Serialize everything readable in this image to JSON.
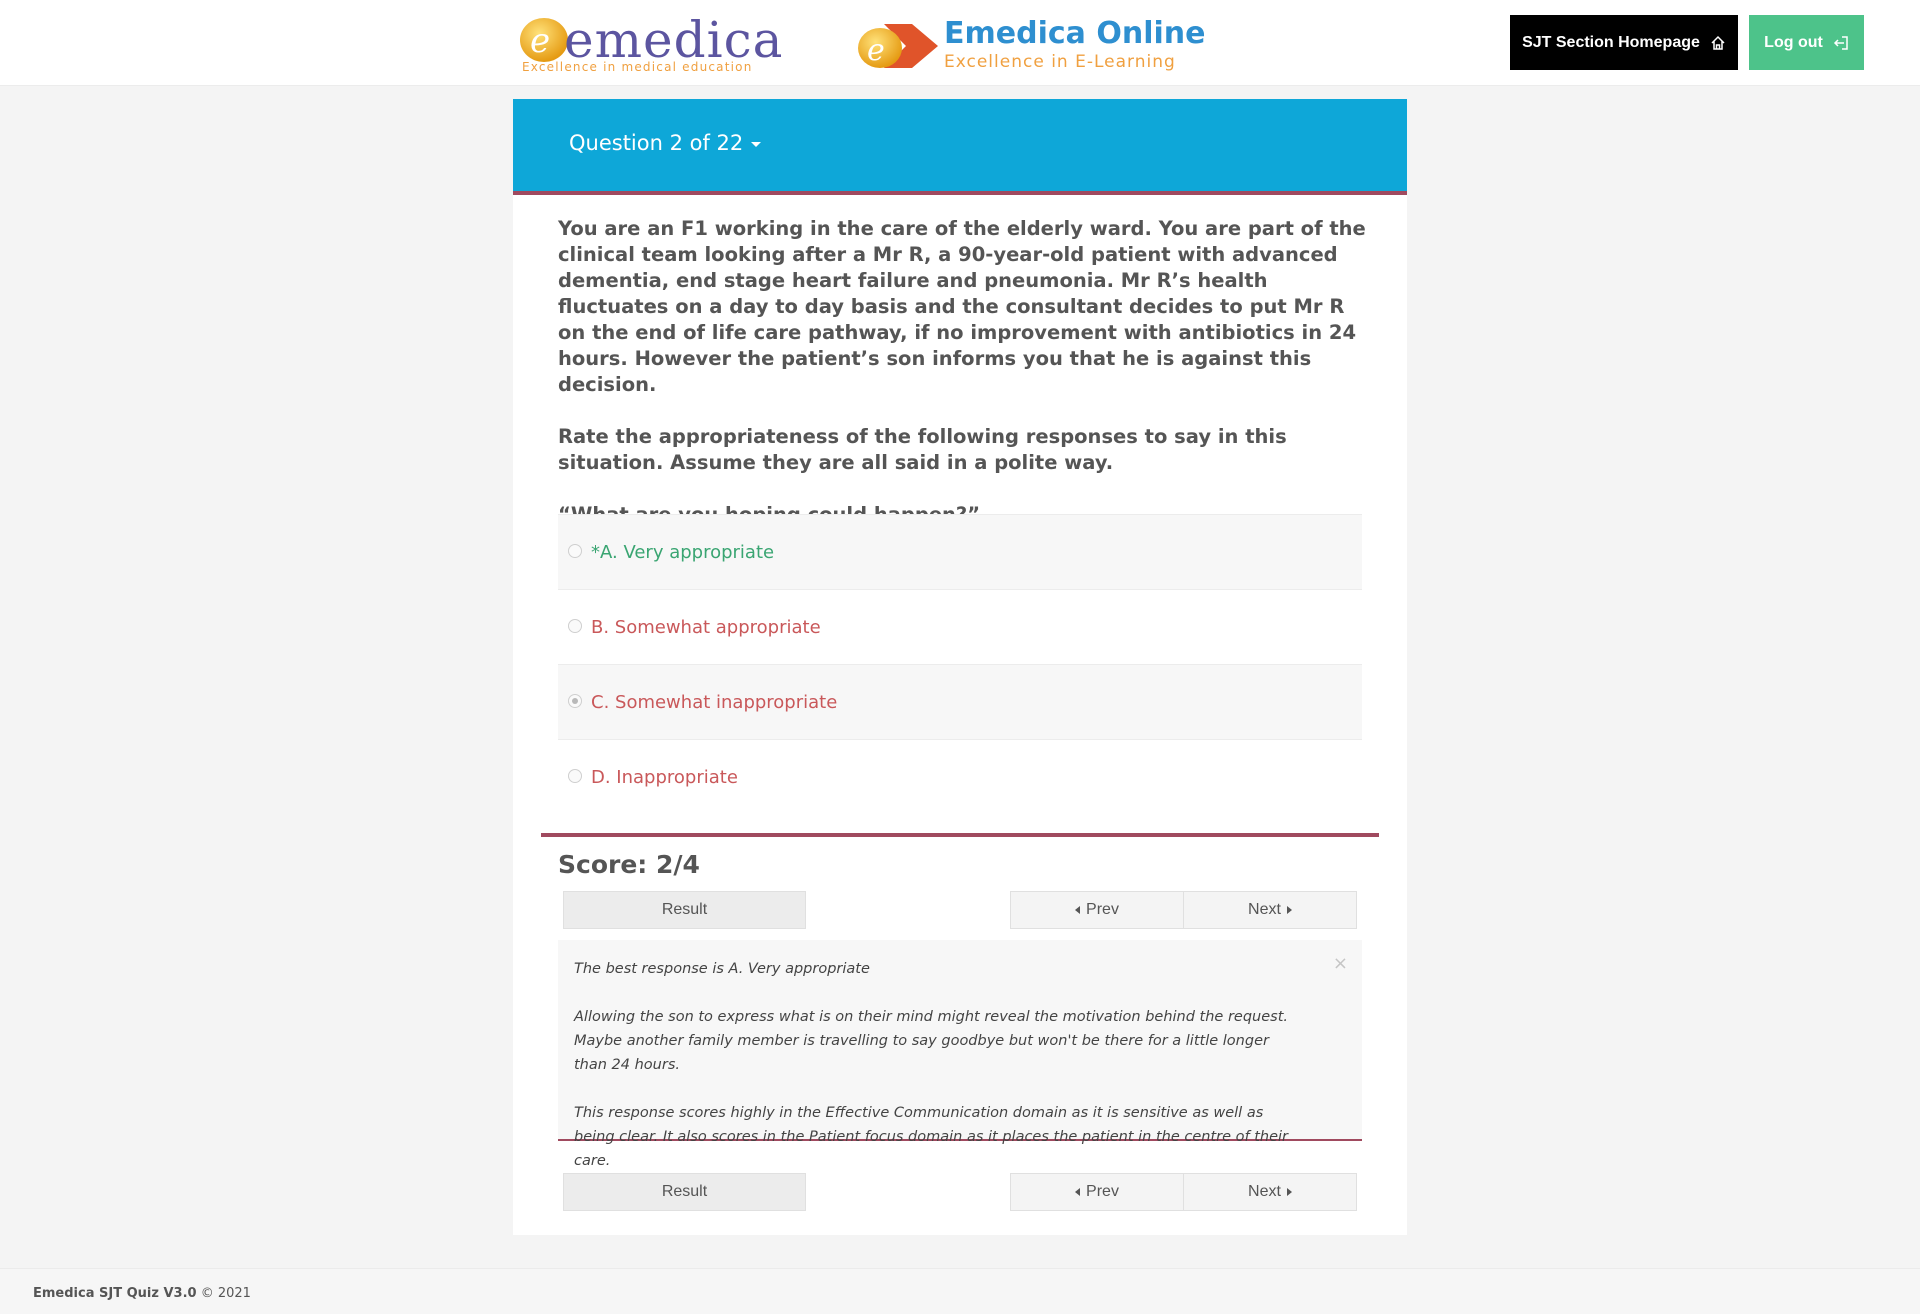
{
  "header": {
    "logo_left": {
      "word": "emedica",
      "tagline": "Excellence in medical education"
    },
    "logo_right": {
      "title": "Emedica Online",
      "tagline": "Excellence in E-Learning"
    },
    "home_button": "SJT Section Homepage",
    "logout_button": "Log out"
  },
  "question": {
    "counter": "Question 2 of 22",
    "stem": [
      "You are an F1 working in the care of the elderly ward. You are part of the clinical team looking after a Mr R, a 90-year-old patient with advanced dementia, end stage heart failure and pneumonia. Mr R’s health fluctuates on a day to day basis and the consultant decides to put Mr R on the end of life care pathway, if no improvement with antibiotics in 24 hours. However the patient’s son informs you that he is against this decision.",
      "Rate the appropriateness of the following responses to say in this situation. Assume they are all said in a polite way.",
      "“What are you hoping could happen?”"
    ],
    "options": [
      {
        "label": "*A. Very appropriate",
        "status": "correct",
        "selected": false
      },
      {
        "label": "B. Somewhat appropriate",
        "status": "incorrect",
        "selected": false
      },
      {
        "label": "C. Somewhat inappropriate",
        "status": "incorrect",
        "selected": true
      },
      {
        "label": "D. Inappropriate",
        "status": "incorrect",
        "selected": false
      }
    ]
  },
  "score": "Score: 2/4",
  "nav": {
    "result": "Result",
    "prev": "Prev",
    "next": "Next"
  },
  "feedback": {
    "paragraphs": [
      "The best response is A. Very appropriate",
      "Allowing the son to express what is on their mind might reveal the motivation behind the request. Maybe another family member is travelling to say goodbye but won't be there for a little longer than 24 hours.",
      "This response scores highly in the Effective Communication domain as it is sensitive as well as being clear. It also scores in the Patient focus domain as it places the patient in the centre of their care."
    ],
    "close": "×"
  },
  "footer": {
    "app": "Emedica SJT Quiz V3.0",
    "copyright": "© 2021"
  },
  "colors": {
    "header_blue": "#0ea7d8",
    "accent_maroon": "#a04a5f",
    "correct_green": "#3aa572",
    "incorrect_red": "#c9585a",
    "logout_green": "#4dc38a"
  }
}
